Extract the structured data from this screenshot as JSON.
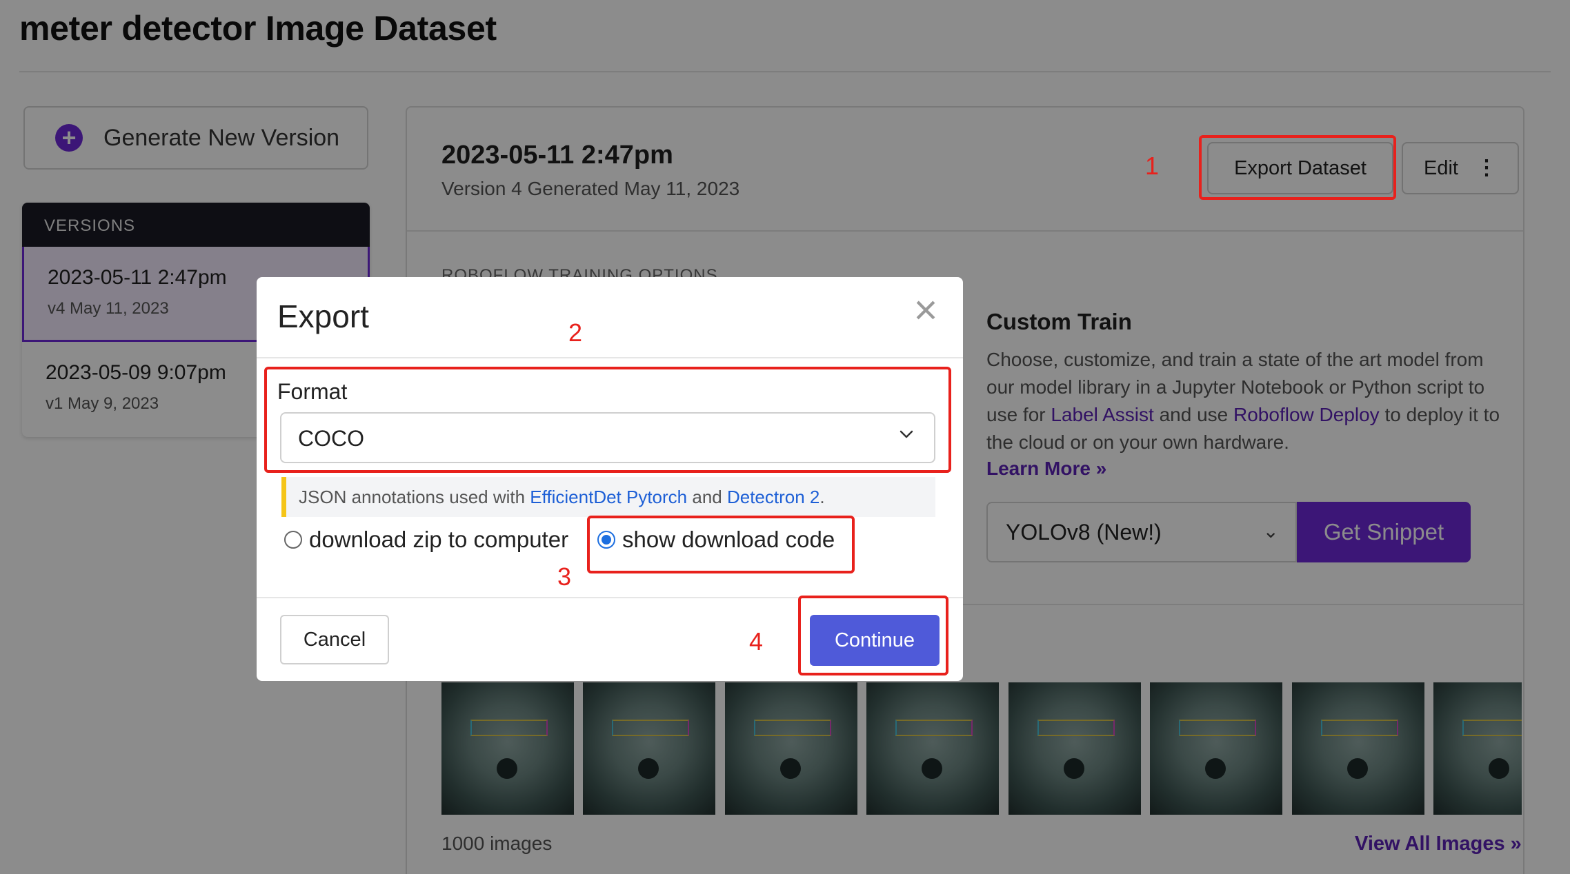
{
  "page": {
    "title": "meter detector Image Dataset",
    "generate_button": "Generate New Version"
  },
  "versions": {
    "header": "VERSIONS",
    "items": [
      {
        "title": "2023-05-11 2:47pm",
        "subtitle": "v4 May 11, 2023",
        "active": true
      },
      {
        "title": "2023-05-09 9:07pm",
        "subtitle": "v1 May 9, 2023",
        "active": false
      }
    ]
  },
  "version_detail": {
    "date": "2023-05-11 2:47pm",
    "subtitle": "Version 4 Generated May 11, 2023",
    "export_button": "Export Dataset",
    "edit_button": "Edit",
    "training_options_label": "ROBOFLOW TRAINING OPTIONS",
    "custom_train": {
      "title": "Custom Train",
      "text_1": "Choose, customize, and train a state of the art model from our model library in a Jupyter Notebook or Python script to use for ",
      "link_1": "Label Assist",
      "text_2": " and use ",
      "link_2": "Roboflow Deploy",
      "text_3": " to deploy it to the cloud or on your own hardware.",
      "learn_more": "Learn More »",
      "model_select": "YOLOv8 (New!)",
      "snippet_button": "Get Snippet"
    },
    "images_count": "1000 images",
    "view_all": "View All Images »"
  },
  "modal": {
    "title": "Export",
    "close_icon": "×",
    "format_label": "Format",
    "format_value": "COCO",
    "hint_text_1": "JSON annotations used with ",
    "hint_link_1": "EfficientDet Pytorch",
    "hint_text_2": " and ",
    "hint_link_2": "Detectron 2",
    "hint_text_3": ".",
    "option_zip": "download zip to computer",
    "option_code": "show download code",
    "selected_option": "show download code",
    "cancel_button": "Cancel",
    "continue_button": "Continue"
  },
  "annotations": {
    "step_1": "1",
    "step_2": "2",
    "step_3": "3",
    "step_4": "4"
  },
  "colors": {
    "accent": "#6d28d9",
    "continue_button": "#4f5ad9",
    "annotation_red": "#e8211c",
    "link_blue": "#1d5fd6"
  },
  "icons": [
    "plus-circle-icon",
    "kebab-icon",
    "chevron-down-icon",
    "close-icon",
    "double-chevron-right-icon"
  ]
}
